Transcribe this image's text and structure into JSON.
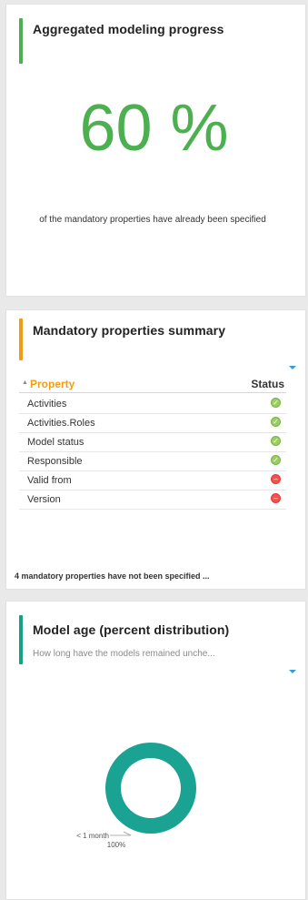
{
  "progress_card": {
    "title": "Aggregated modeling progress",
    "percent_text": "60 %",
    "description": "of the mandatory properties have already been specified",
    "accent_color": "#4caf50"
  },
  "summary_card": {
    "title": "Mandatory properties summary",
    "accent_color": "#f39c12",
    "columns": {
      "property": "Property",
      "status": "Status"
    },
    "rows": [
      {
        "property": "Activities",
        "status": "ok"
      },
      {
        "property": "Activities.Roles",
        "status": "ok"
      },
      {
        "property": "Model status",
        "status": "ok"
      },
      {
        "property": "Responsible",
        "status": "ok"
      },
      {
        "property": "Valid from",
        "status": "missing"
      },
      {
        "property": "Version",
        "status": "missing"
      }
    ],
    "footer": "4 mandatory properties have not been specified ..."
  },
  "age_card": {
    "title": "Model age (percent distribution)",
    "subtitle": "How long have the models remained unche...",
    "accent_color": "#16a085",
    "chart_data": {
      "type": "pie",
      "categories": [
        "< 1 month"
      ],
      "values": [
        100
      ],
      "data_labels": [
        "100%"
      ],
      "colors": [
        "#1aa392"
      ]
    }
  }
}
